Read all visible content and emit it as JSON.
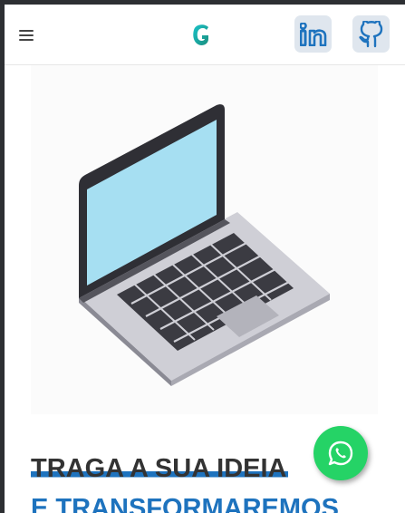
{
  "header": {
    "menu_icon": "hamburger-menu-icon",
    "logo_icon": "g-logo-icon",
    "social": [
      {
        "name": "LinkedIn",
        "icon": "linkedin-icon"
      },
      {
        "name": "GitHub",
        "icon": "github-icon"
      }
    ]
  },
  "hero": {
    "image_icon": "laptop-illustration",
    "headline_line1": "TRAGA A SUA IDEIA",
    "headline_line2": "E TRANSFORMAREMOS"
  },
  "whatsapp": {
    "icon": "whatsapp-icon"
  },
  "colors": {
    "accent": "#1e73be",
    "social_bg": "#dfe6ee",
    "whatsapp": "#25d366",
    "headline_dark": "#333333"
  }
}
